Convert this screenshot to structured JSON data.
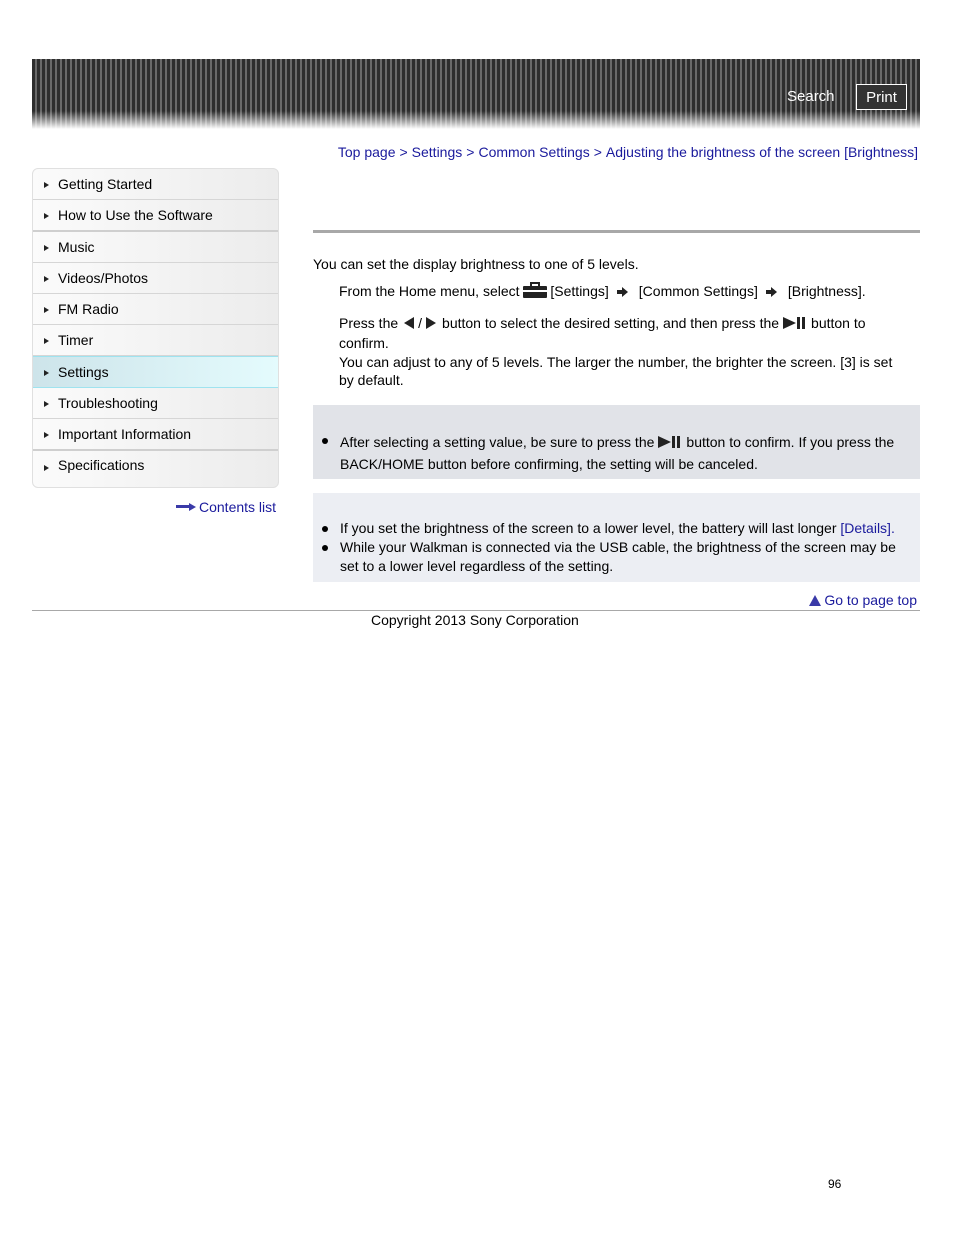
{
  "header": {
    "search_label": "Search",
    "print_label": "Print"
  },
  "breadcrumb": {
    "items": [
      "Top page",
      "Settings",
      "Common Settings",
      "Adjusting the brightness of the screen [Brightness]"
    ],
    "separator": ">"
  },
  "sidebar": {
    "items": [
      {
        "label": "Getting Started",
        "active": false
      },
      {
        "label": "How to Use the Software",
        "active": false
      },
      {
        "label": "Music",
        "active": false
      },
      {
        "label": "Videos/Photos",
        "active": false
      },
      {
        "label": "FM Radio",
        "active": false
      },
      {
        "label": "Timer",
        "active": false
      },
      {
        "label": "Settings",
        "active": true
      },
      {
        "label": "Troubleshooting",
        "active": false
      },
      {
        "label": "Important Information",
        "active": false
      },
      {
        "label": "Specifications",
        "active": false
      }
    ],
    "contents_list_label": "Contents list"
  },
  "main": {
    "intro": "You can set the display brightness to one of 5 levels.",
    "step1": {
      "prefix": "From the Home menu, select",
      "settings": "[Settings]",
      "common_settings": "[Common Settings]",
      "brightness": "[Brightness]."
    },
    "step2": {
      "press_the": "Press the",
      "slash": "/",
      "middle": "button to select the desired setting, and then press the",
      "suffix": "button to confirm.",
      "detail": "You can adjust to any of 5 levels. The larger the number, the brighter the screen. [3] is set by default."
    },
    "note": {
      "prefix": "After selecting a setting value, be sure to press the",
      "suffix": "button to confirm. If you press the BACK/HOME button before confirming, the setting will be canceled."
    },
    "hints": {
      "item1_text": "If you set the brightness of the screen to a lower level, the battery will last longer",
      "item1_link": "[Details].",
      "item2_text": "While your Walkman is connected via the USB cable, the brightness of the screen may be set to a lower level regardless of the setting."
    }
  },
  "footer": {
    "page_top_label": "Go to page top",
    "copyright": "Copyright 2013 Sony Corporation",
    "page_number": "96"
  },
  "colors": {
    "link": "#1a1a9c",
    "active_nav": "#e4fbfd",
    "note_bg": "#e1e3e8",
    "hint_bg": "#eceef3"
  }
}
